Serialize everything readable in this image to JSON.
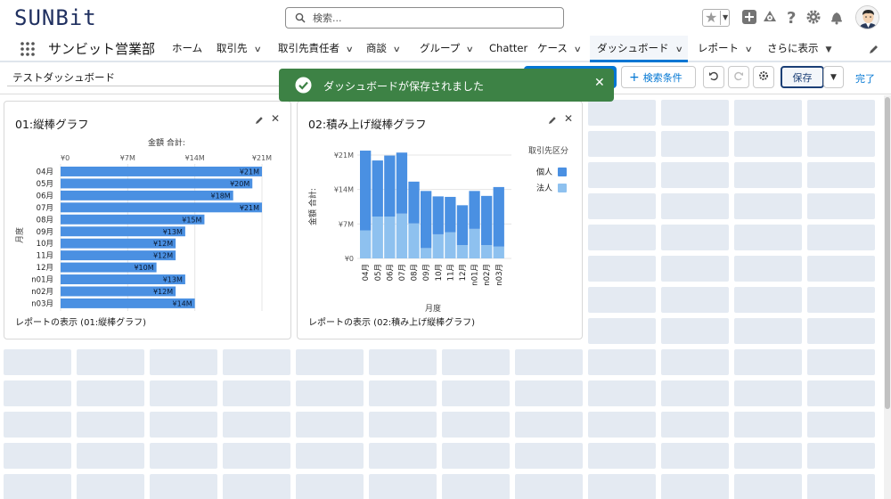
{
  "header": {
    "logo": "SUNBit",
    "search_placeholder": "検索...",
    "icons": [
      "star-icon",
      "add-icon",
      "trailhead-icon",
      "help-icon",
      "gear-icon",
      "bell-icon",
      "avatar"
    ]
  },
  "nav": {
    "app_name": "サンビット営業部",
    "items": [
      {
        "label": "ホーム",
        "chevron": false
      },
      {
        "label": "取引先",
        "chevron": true
      },
      {
        "label": "取引先責任者",
        "chevron": true
      },
      {
        "label": "商談",
        "chevron": true
      },
      {
        "label": "グループ",
        "chevron": true
      },
      {
        "label": "Chatter",
        "chevron": false
      },
      {
        "label": "ケース",
        "chevron": true
      },
      {
        "label": "ダッシュボード",
        "chevron": true,
        "active": true
      },
      {
        "label": "レポート",
        "chevron": true
      },
      {
        "label": "さらに表示",
        "chevron": true
      }
    ]
  },
  "toolbar": {
    "dashboard_title": "テストダッシュボード",
    "filter_label": "検索条件",
    "save_label": "保存",
    "done_label": "完了"
  },
  "toast": {
    "message": "ダッシュボードが保存されました"
  },
  "widget1": {
    "title": "01:縦棒グラフ",
    "footer": "レポートの表示 (01:縦棒グラフ)"
  },
  "widget2": {
    "title": "02:積み上げ縦棒グラフ",
    "footer": "レポートの表示 (02:積み上げ縦棒グラフ)"
  },
  "colors": {
    "bar": "#4a90e2",
    "bar_light": "#8ec1ef",
    "toast": "#3d8245",
    "accent": "#0176d3"
  },
  "chart_data": [
    {
      "type": "bar",
      "orientation": "horizontal",
      "xlabel": "金額 合計:",
      "ylabel": "月度",
      "xticks": [
        "¥0",
        "¥7M",
        "¥14M",
        "¥21M"
      ],
      "xlim": [
        0,
        21
      ],
      "categories": [
        "04月",
        "05月",
        "06月",
        "07月",
        "08月",
        "09月",
        "10月",
        "11月",
        "12月",
        "n01月",
        "n02月",
        "n03月"
      ],
      "values": [
        21,
        20,
        18,
        21,
        15,
        13,
        12,
        12,
        10,
        13,
        12,
        14
      ],
      "labels": [
        "¥21M",
        "¥20M",
        "¥18M",
        "¥21M",
        "¥15M",
        "¥13M",
        "¥12M",
        "¥12M",
        "¥10M",
        "¥13M",
        "¥12M",
        "¥14M"
      ]
    },
    {
      "type": "bar",
      "stacked": true,
      "xlabel": "月度",
      "ylabel": "金額 合計:",
      "legend_title": "取引先区分",
      "legend_position": "right",
      "yticks": [
        "¥21M",
        "¥14M",
        "¥7M",
        "¥0"
      ],
      "ylim": [
        0,
        21
      ],
      "categories": [
        "04月",
        "05月",
        "06月",
        "07月",
        "08月",
        "09月",
        "10月",
        "11月",
        "12月",
        "n01月",
        "n02月",
        "n03月"
      ],
      "series": [
        {
          "name": "法人",
          "values": [
            5.7,
            8.5,
            8.5,
            9.1,
            7.1,
            2.1,
            4.9,
            5.3,
            2.7,
            6.0,
            2.7,
            2.4
          ]
        },
        {
          "name": "個人",
          "values": [
            16.2,
            11.4,
            12.4,
            12.4,
            8.5,
            11.6,
            7.7,
            7.2,
            8.1,
            7.7,
            10.0,
            12.1
          ]
        }
      ]
    }
  ]
}
